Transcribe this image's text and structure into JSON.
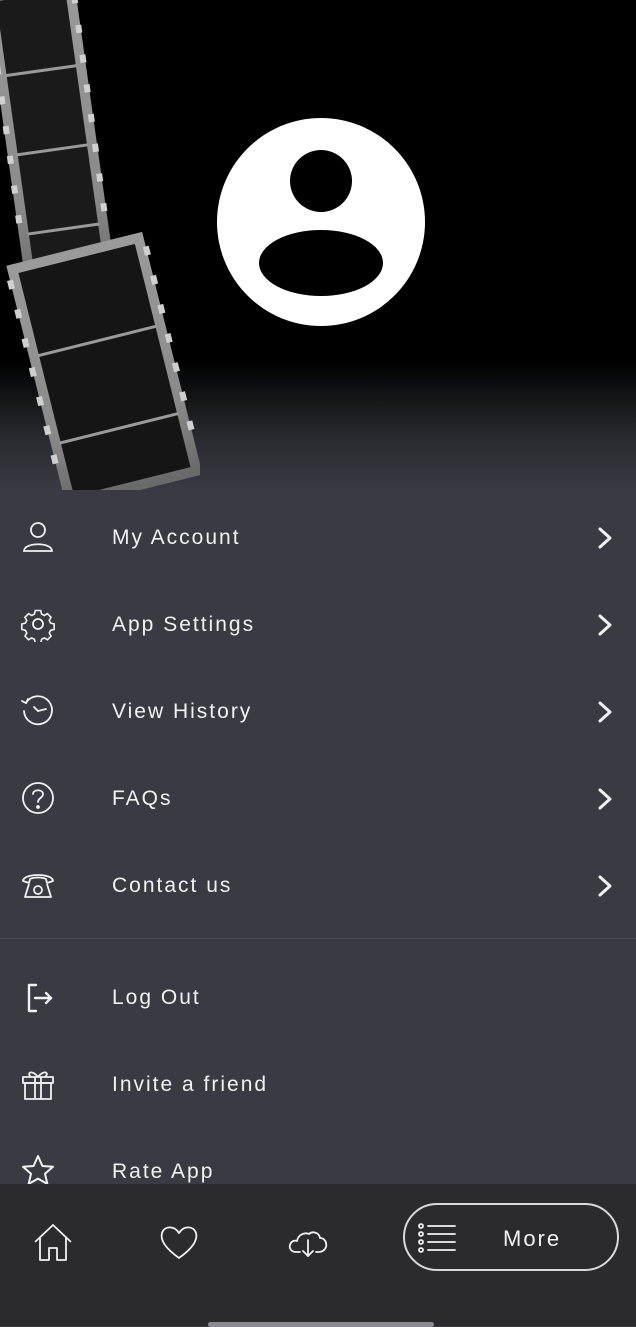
{
  "menu": {
    "primary": [
      {
        "label": "My Account",
        "icon": "user-icon"
      },
      {
        "label": "App Settings",
        "icon": "gear-icon"
      },
      {
        "label": "View History",
        "icon": "history-icon"
      },
      {
        "label": "FAQs",
        "icon": "question-icon"
      },
      {
        "label": "Contact us",
        "icon": "phone-icon"
      }
    ],
    "secondary": [
      {
        "label": "Log Out",
        "icon": "logout-icon"
      },
      {
        "label": "Invite a friend",
        "icon": "gift-icon"
      },
      {
        "label": "Rate App",
        "icon": "star-icon"
      }
    ]
  },
  "bottom_nav": {
    "items": [
      {
        "icon": "home-icon"
      },
      {
        "icon": "heart-icon"
      },
      {
        "icon": "cloud-download-icon"
      }
    ],
    "more_label": "More"
  },
  "colors": {
    "background": "#393a42",
    "nav_background": "#2b2b2e",
    "text": "#f2f2f4"
  }
}
